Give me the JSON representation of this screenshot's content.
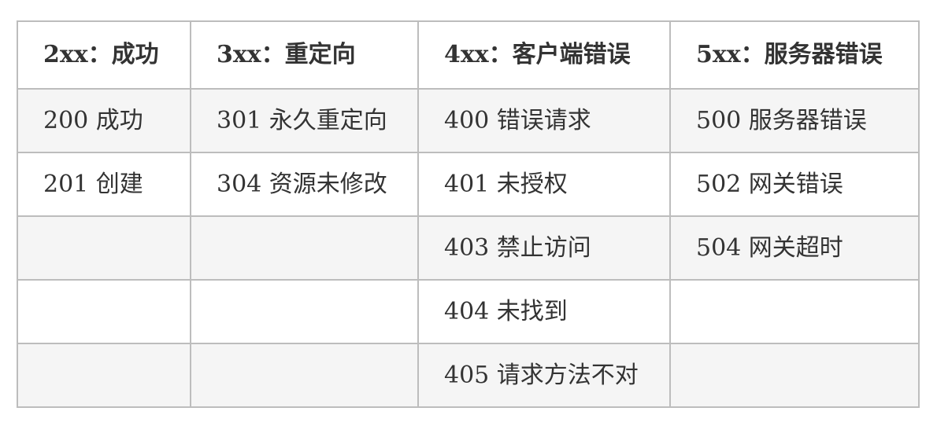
{
  "table": {
    "headers": [
      "2xx：成功",
      "3xx：重定向",
      "4xx：客户端错误",
      "5xx：服务器错误"
    ],
    "rows": [
      [
        "200 成功",
        "301 永久重定向",
        "400 错误请求",
        "500 服务器错误"
      ],
      [
        "201 创建",
        "304 资源未修改",
        "401 未授权",
        "502 网关错误"
      ],
      [
        "",
        "",
        "403 禁止访问",
        "504 网关超时"
      ],
      [
        "",
        "",
        "404 未找到",
        ""
      ],
      [
        "",
        "",
        "405 请求方法不对",
        ""
      ]
    ]
  }
}
